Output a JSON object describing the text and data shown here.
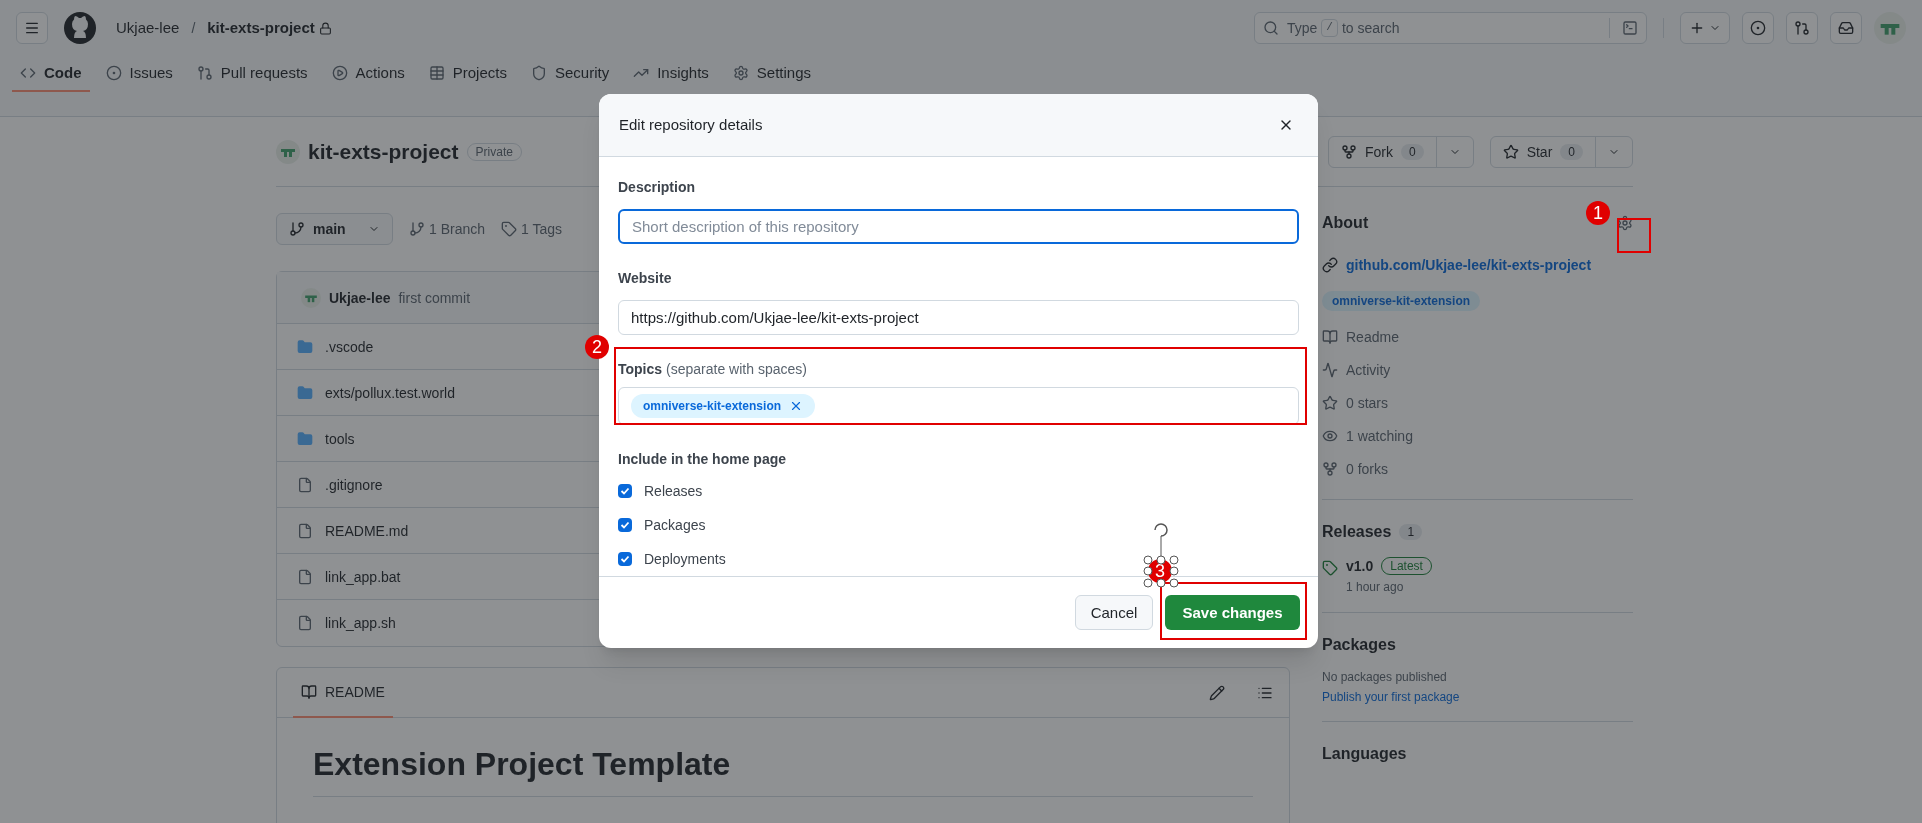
{
  "header": {
    "owner": "Ukjae-lee",
    "separator": "/",
    "repo": "kit-exts-project",
    "search": [
      "Type",
      "/",
      "to search"
    ]
  },
  "tabs": [
    {
      "label": "Code",
      "kind": "code",
      "selected": true
    },
    {
      "label": "Issues",
      "kind": "issues",
      "selected": false
    },
    {
      "label": "Pull requests",
      "kind": "pulls",
      "selected": false
    },
    {
      "label": "Actions",
      "kind": "actions",
      "selected": false
    },
    {
      "label": "Projects",
      "kind": "projects",
      "selected": false
    },
    {
      "label": "Security",
      "kind": "security",
      "selected": false
    },
    {
      "label": "Insights",
      "kind": "insights",
      "selected": false
    },
    {
      "label": "Settings",
      "kind": "settings",
      "selected": false
    }
  ],
  "repo": {
    "title": "kit-exts-project",
    "visibility": "Private",
    "fork": {
      "label": "Fork",
      "count": "0"
    },
    "star": {
      "label": "Star",
      "count": "0"
    }
  },
  "branch_bar": {
    "branch": "main",
    "branches": "1 Branch",
    "tags": "1 Tags"
  },
  "commit": {
    "author": "Ukjae-lee",
    "message": "first commit"
  },
  "files": [
    {
      "name": ".vscode",
      "kind": "folder"
    },
    {
      "name": "exts/pollux.test.world",
      "kind": "folder"
    },
    {
      "name": "tools",
      "kind": "folder"
    },
    {
      "name": ".gitignore",
      "kind": "file"
    },
    {
      "name": "README.md",
      "kind": "file"
    },
    {
      "name": "link_app.bat",
      "kind": "file"
    },
    {
      "name": "link_app.sh",
      "kind": "file"
    }
  ],
  "readme": {
    "tab": "README",
    "heading": "Extension Project Template"
  },
  "sidebar": {
    "about": "About",
    "link": "github.com/Ukjae-lee/kit-exts-project",
    "topic": "omniverse-kit-extension",
    "items": [
      {
        "label": "Readme",
        "kind": "readme"
      },
      {
        "label": "Activity",
        "kind": "activity"
      },
      {
        "label": "0 stars",
        "kind": "stars"
      },
      {
        "label": "1 watching",
        "kind": "watching"
      },
      {
        "label": "0 forks",
        "kind": "forks"
      }
    ],
    "releases": {
      "title": "Releases",
      "count": "1",
      "version": "v1.0",
      "badge": "Latest",
      "time": "1 hour ago"
    },
    "packages": {
      "title": "Packages",
      "note": "No packages published",
      "link": "Publish your first package"
    },
    "languages": "Languages"
  },
  "modal": {
    "title": "Edit repository details",
    "description_label": "Description",
    "description_placeholder": "Short description of this repository",
    "website_label": "Website",
    "website_value": "https://github.com/Ukjae-lee/kit-exts-project",
    "topics_label": "Topics",
    "topics_hint": "(separate with spaces)",
    "topics": [
      "omniverse-kit-extension"
    ],
    "include_label": "Include in the home page",
    "options": [
      {
        "label": "Releases",
        "checked": true
      },
      {
        "label": "Packages",
        "checked": true
      },
      {
        "label": "Deployments",
        "checked": true
      }
    ],
    "cancel": "Cancel",
    "save": "Save changes"
  },
  "annotations": [
    {
      "label": "1"
    },
    {
      "label": "2"
    },
    {
      "label": "3"
    }
  ]
}
